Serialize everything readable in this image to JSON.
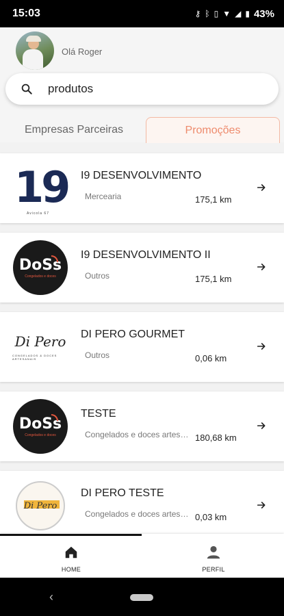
{
  "status_bar": {
    "time": "15:03",
    "icons": [
      "key-icon",
      "bluetooth-icon",
      "vibrate-icon",
      "wifi-icon",
      "signal-icon",
      "battery-icon"
    ],
    "battery": "43%"
  },
  "header": {
    "greeting": "Olá Roger"
  },
  "search": {
    "value": "produtos"
  },
  "tabs": [
    {
      "label": "Empresas Parceiras",
      "active": false
    },
    {
      "label": "Promoções",
      "active": true
    }
  ],
  "list": [
    {
      "name": "I9 DESENVOLVIMENTO",
      "category": "Mercearia",
      "distance": "175,1 km",
      "logo": "i9-logo",
      "logo_text": "19",
      "logo_subtext": "Avicola 67"
    },
    {
      "name": "I9 DESENVOLVIMENTO II",
      "category": "Outros",
      "distance": "175,1 km",
      "logo": "doss-logo",
      "logo_text": "DoSs",
      "logo_subtext": "Congelados e doces"
    },
    {
      "name": "DI PERO GOURMET",
      "category": "Outros",
      "distance": "0,06 km",
      "logo": "dipero-logo",
      "logo_text": "Di Pero",
      "logo_subtext": "CONGELADOS & DOCES ARTESANAIS"
    },
    {
      "name": "TESTE",
      "category": "Congelados e doces artesanais",
      "distance": "180,68 km",
      "logo": "doss-logo",
      "logo_text": "DoSs",
      "logo_subtext": "Congelados e doces"
    },
    {
      "name": "DI PERO TESTE",
      "category": "Congelados e doces artesanais",
      "distance": "0,03 km",
      "logo": "dipero-circle-logo",
      "logo_text": "Di Pero"
    }
  ],
  "bottom_nav": [
    {
      "label": "HOME",
      "icon": "home-icon",
      "active": true
    },
    {
      "label": "PERFIL",
      "icon": "person-icon",
      "active": false
    }
  ],
  "colors": {
    "accent": "#ee8b6d",
    "tab_border": "#f3b9a3",
    "brand_navy": "#1b2a55",
    "brand_yellow": "#f0b53c",
    "brand_red": "#e3573e"
  }
}
